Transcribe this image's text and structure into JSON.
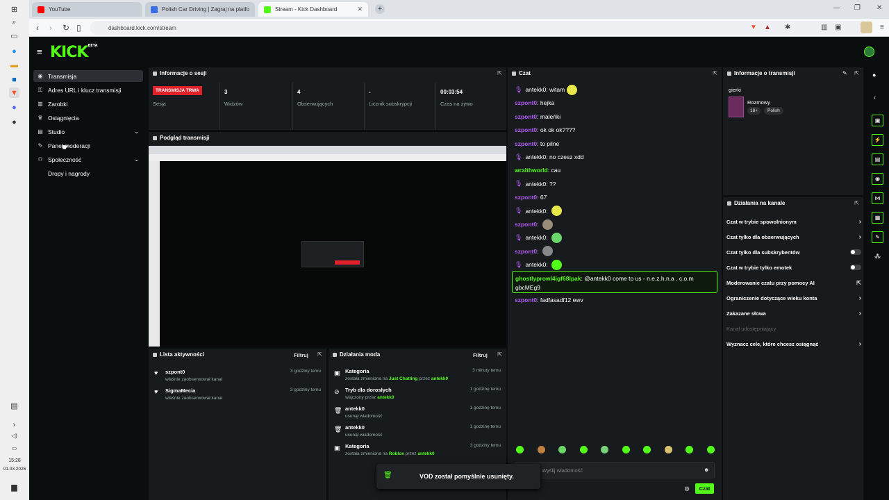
{
  "browser": {
    "tabs": [
      {
        "title": "YouTube",
        "color": "#ff0000"
      },
      {
        "title": "Polish Car Driving | Zagraj na platfor",
        "color": "#3a6ee8"
      },
      {
        "title": "Stream - Kick Dashboard",
        "color": "#53fc18"
      }
    ],
    "url": "dashboard.kick.com/stream"
  },
  "taskbar": {
    "time": "15:28",
    "date": "01.03.2026"
  },
  "app": {
    "logo": "KICK",
    "logo_badge": "BETA"
  },
  "sidebar": {
    "items": [
      {
        "label": "Transmisja",
        "icon": "broadcast-icon"
      },
      {
        "label": "Adres URL i klucz transmisji",
        "icon": "key-icon"
      },
      {
        "label": "Zarobki",
        "icon": "chart-icon"
      },
      {
        "label": "Osiągnięcia",
        "icon": "trophy-icon"
      },
      {
        "label": "Studio",
        "icon": "folder-icon"
      },
      {
        "label": "Panel moderacji",
        "icon": "wrench-icon"
      },
      {
        "label": "Społeczność",
        "icon": "users-icon"
      },
      {
        "label": "Dropy i nagrody",
        "icon": "gift-icon"
      }
    ]
  },
  "session": {
    "title": "Informacje o sesji",
    "live_badge": "TRANSMISJA TRWA",
    "live_label": "Sesja",
    "stats": [
      {
        "value": "3",
        "label": "Widzów"
      },
      {
        "value": "4",
        "label": "Obserwujących"
      },
      {
        "value": "-",
        "label": "Licznik subskrypcji"
      },
      {
        "value": "00:03:54",
        "label": "Czas na żywo"
      }
    ]
  },
  "preview": {
    "title": "Podgląd transmisji"
  },
  "activity": {
    "title": "Lista aktywności",
    "filter": "Filtruj",
    "items": [
      {
        "name": "szpont0",
        "desc": "właśnie zaobserwował kanał",
        "time": "3 godziny temu"
      },
      {
        "name": "SigmaMecia",
        "desc": "właśnie zaobserwował kanał",
        "time": "3 godziny temu"
      }
    ]
  },
  "modactions": {
    "title": "Działania moda",
    "filter": "Filtruj",
    "items": [
      {
        "name": "Kategoria",
        "desc1": "została zmieniona na ",
        "hl": "Just Chatting",
        "desc2": " przez ",
        "by": "antekk0",
        "time": "3 minuty temu"
      },
      {
        "name": "Tryb dla dorosłych",
        "desc1": "włączony przez ",
        "hl": "",
        "desc2": "",
        "by": "antekk0",
        "time": "1 godzinę temu"
      },
      {
        "name": "antekk0",
        "desc1": "usunął wiadomość",
        "hl": "",
        "desc2": "",
        "by": "",
        "time": "1 godzinę temu"
      },
      {
        "name": "antekk0",
        "desc1": "usunął wiadomość",
        "hl": "",
        "desc2": "",
        "by": "",
        "time": "1 godzinę temu"
      },
      {
        "name": "Kategoria",
        "desc1": "została zmieniona na ",
        "hl": "Roblox",
        "desc2": " przez ",
        "by": "antekk0",
        "time": "3 godziny temu"
      }
    ]
  },
  "chat": {
    "title": "Czat",
    "messages": [
      {
        "user": "antekk0",
        "mod": true,
        "text": "witam",
        "emote": "#e8e84a"
      },
      {
        "user": "szpont0",
        "mod": false,
        "text": "hejka",
        "emote": ""
      },
      {
        "user": "szpont0",
        "mod": false,
        "text": "maleńki",
        "emote": ""
      },
      {
        "user": "szpont0",
        "mod": false,
        "text": "ok ok ok????",
        "emote": ""
      },
      {
        "user": "szpont0",
        "mod": false,
        "text": "to pilne",
        "emote": ""
      },
      {
        "user": "antekk0",
        "mod": true,
        "text": "no czesz xdd",
        "emote": ""
      },
      {
        "user": "wraithworld",
        "mod": false,
        "text": "cau",
        "emote": ""
      },
      {
        "user": "antekk0",
        "mod": true,
        "text": "??",
        "emote": ""
      },
      {
        "user": "szpont0",
        "mod": false,
        "text": "67",
        "emote": ""
      },
      {
        "user": "antekk0",
        "mod": true,
        "text": "",
        "emote": "#e8e84a"
      },
      {
        "user": "szpont0",
        "mod": false,
        "text": "",
        "emote": "#9b8c7a"
      },
      {
        "user": "antekk0",
        "mod": true,
        "text": "",
        "emote": "#6ad66a"
      },
      {
        "user": "szpont0",
        "mod": false,
        "text": "",
        "emote": "#888888"
      },
      {
        "user": "antekk0",
        "mod": true,
        "text": "",
        "emote": "#53fc18"
      }
    ],
    "highlight": {
      "user": "ghostlyprowl4igf68lpak",
      "text": "@antekk0 come to us - n.e.z.h.n.a . c.o.m gbcMEg9"
    },
    "last": {
      "user": "szpont0",
      "text": "fadfasadf12 ewv"
    },
    "input_placeholder": "Wyślij wiadomość",
    "send_label": "Czat"
  },
  "stream_info": {
    "title": "Informacje o transmisji",
    "name": "gierki",
    "category": "Rozmowy",
    "tags": [
      "18+",
      "Polish"
    ]
  },
  "channel_actions": {
    "title": "Działania na kanale",
    "rows": [
      {
        "label": "Czat w trybie spowolnionym",
        "kind": "chev"
      },
      {
        "label": "Czat tylko dla obserwujących",
        "kind": "chev"
      },
      {
        "label": "Czat tylko dla subskrybentów",
        "kind": "toggle"
      },
      {
        "label": "Czat w trybie tylko emotek",
        "kind": "toggle"
      },
      {
        "label": "Moderowanie czatu przy pomocy AI",
        "kind": "ext"
      },
      {
        "label": "Ograniczenie dotyczące wieku konta",
        "kind": "chev"
      },
      {
        "label": "Zakazane słowa",
        "kind": "chev"
      },
      {
        "label": "Kanał udostępniający",
        "kind": "dim"
      },
      {
        "label": "Wyznacz cele, które chcesz osiągnąć",
        "kind": "chev"
      }
    ]
  },
  "toast": {
    "text": "VOD został pomyślnie usunięty."
  }
}
